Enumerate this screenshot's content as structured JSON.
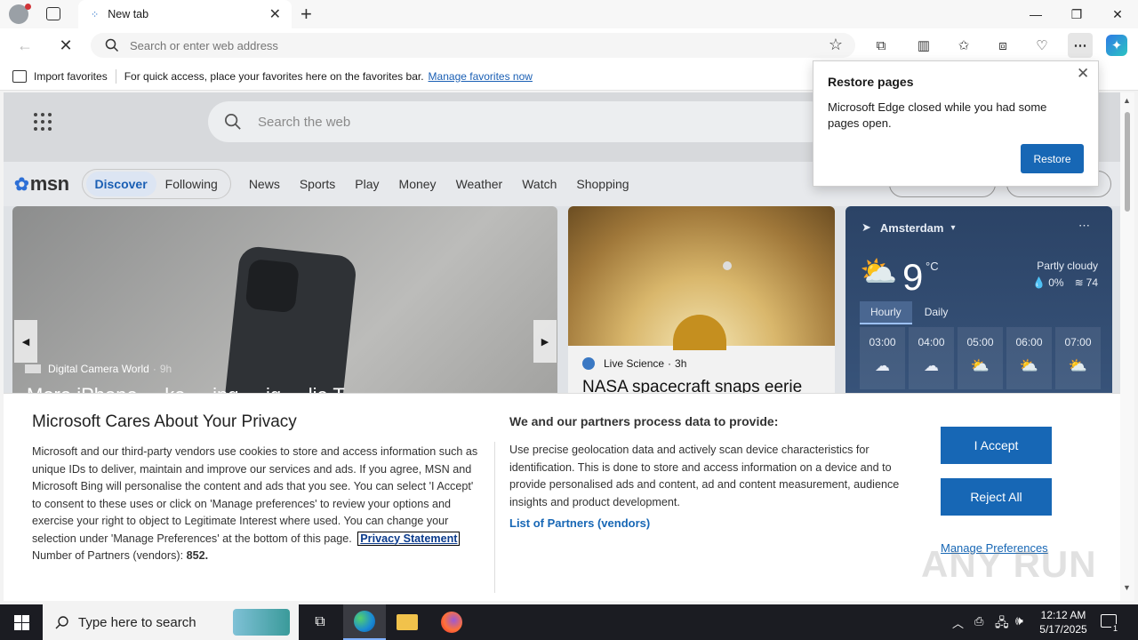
{
  "browser": {
    "tab_title": "New tab",
    "address_placeholder": "Search or enter web address",
    "favorites_import": "Import favorites",
    "favorites_hint": "For quick access, place your favorites here on the favorites bar.",
    "favorites_manage": "Manage favorites now"
  },
  "restore_popup": {
    "title": "Restore pages",
    "message": "Microsoft Edge closed while you had some pages open.",
    "button": "Restore"
  },
  "msn": {
    "search_placeholder": "Search the web",
    "logo": "msn",
    "tabs": [
      "Discover",
      "Following"
    ],
    "nav": [
      "News",
      "Sports",
      "Play",
      "Money",
      "Weather",
      "Watch",
      "Shopping"
    ],
    "card1": {
      "source": "Digital Camera World",
      "time": "9h",
      "headline": "More iPhone ... ke ... ing ... ig ... lie T..."
    },
    "card2": {
      "source": "Live Science",
      "time": "3h",
      "headline": "NASA spacecraft snaps eerie"
    },
    "weather": {
      "city": "Amsterdam",
      "temp": "9",
      "unit": "°C",
      "condition": "Partly cloudy",
      "precip": "0%",
      "humidity": "74",
      "tabs": [
        "Hourly",
        "Daily"
      ],
      "hours": [
        "03:00",
        "04:00",
        "05:00",
        "06:00",
        "07:00"
      ]
    }
  },
  "privacy": {
    "title": "Microsoft Cares About Your Privacy",
    "body": "Microsoft and our third-party vendors use cookies to store and access information such as unique IDs to deliver, maintain and improve our services and ads. If you agree, MSN and Microsoft Bing will personalise the content and ads that you see. You can select 'I Accept' to consent to these uses or click on 'Manage preferences' to review your options and exercise your right to object to Legitimate Interest where used.  You can change your selection under 'Manage Preferences' at the bottom of this page.",
    "privacy_link": "Privacy Statement",
    "partners_label": "Number of Partners (vendors):",
    "partners_count": "852.",
    "right_title": "We and our partners process data to provide:",
    "right_body": "Use precise geolocation data and actively scan device characteristics for identification. This is done to store and access information on a device and to provide personalised ads and content, ad and content measurement, audience insights and product development.",
    "partners_link": "List of Partners (vendors)",
    "accept": "I Accept",
    "reject": "Reject All",
    "manage": "Manage Preferences"
  },
  "watermark": "ANY RUN",
  "taskbar": {
    "search_placeholder": "Type here to search",
    "time": "12:12 AM",
    "date": "5/17/2025",
    "notification_count": "1"
  }
}
